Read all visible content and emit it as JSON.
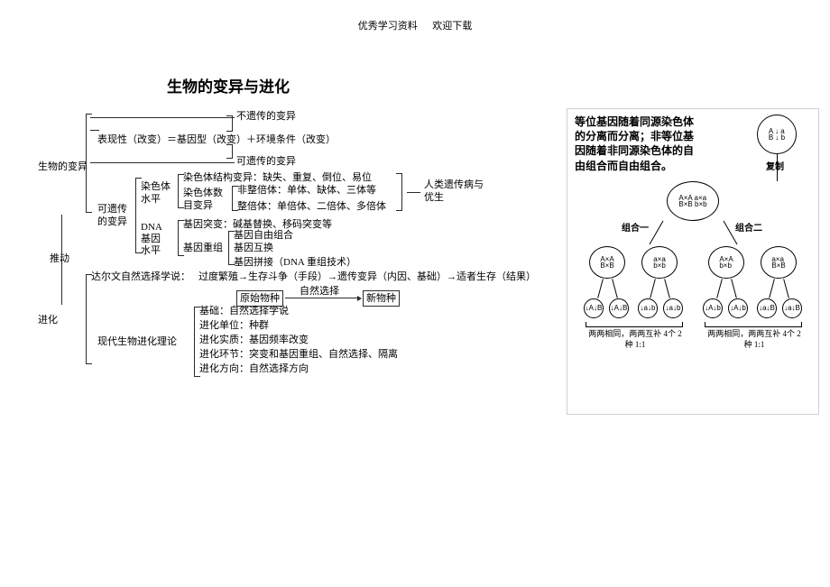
{
  "header": {
    "left": "优秀学习资料",
    "right": "欢迎下载"
  },
  "title": "生物的变异与进化",
  "diagram": {
    "root_variation": "生物的变异",
    "non_heritable": "不遗传的变异",
    "phenotype": "表现性（改变）＝基因型（改变）＋环境条件（改变）",
    "heritable_branch": "可遗传的变异",
    "heritable": "可遗传的变异",
    "chromosome_level": "染色体水平",
    "chrom_struct": "染色体结构变异：缺失、重复、倒位、易位",
    "chrom_num": "染色体数目变异",
    "aneuploid": "非整倍体：单体、缺体、三体等",
    "euploid": "整倍体：单倍体、二倍体、多倍体",
    "genetic_disease": "人类遗传病与优生",
    "dna_level": "DNA水平",
    "gene_mutation_label": "基因突变：碱基替换、移码突变等",
    "gene_gene": "基因",
    "gene_recomb": "基因重组",
    "recomb1": "基因自由组合",
    "recomb2": "基因互换",
    "recomb3": "基因拼接（DNA 重组技术）",
    "push": "推动",
    "darwin": "达尔文自然选择学说：",
    "darwin_steps": "过度繁殖→生存斗争（手段）→遗传变异（内因、基础）→适者生存（结果）",
    "evolution": "进化",
    "original": "原始物种",
    "natural_sel": "自然选择",
    "new_species": "新物种",
    "modern_theory": "现代生物进化理论",
    "theory1": "基础：自然选择学说",
    "theory2": "进化单位：种群",
    "theory3": "进化实质：基因频率改变",
    "theory4": "进化环节：突变和基因重组、自然选择、隔离",
    "theory5": "进化方向：自然选择方向"
  },
  "genetics": {
    "desc": "等位基因随着同源染色体的分离而分离；非等位基因随着非同源染色体的自由组合而自由组合。",
    "top_alleles": "A↓a  B↓b",
    "replicate": "复制",
    "group1": "组合一",
    "group2": "组合二",
    "mid_pair": "A×A a×a  B×B b×b",
    "g1_left": "A×A  B×B",
    "g1_right": "a×a  b×b",
    "g2_left": "A×A  b×b",
    "g2_right": "a×a  B×B",
    "bottom_left": "两两相同，两两互补  4个  2种  1:1",
    "bottom_right": "两两相同，两两互补  4个  2种  1:1"
  }
}
